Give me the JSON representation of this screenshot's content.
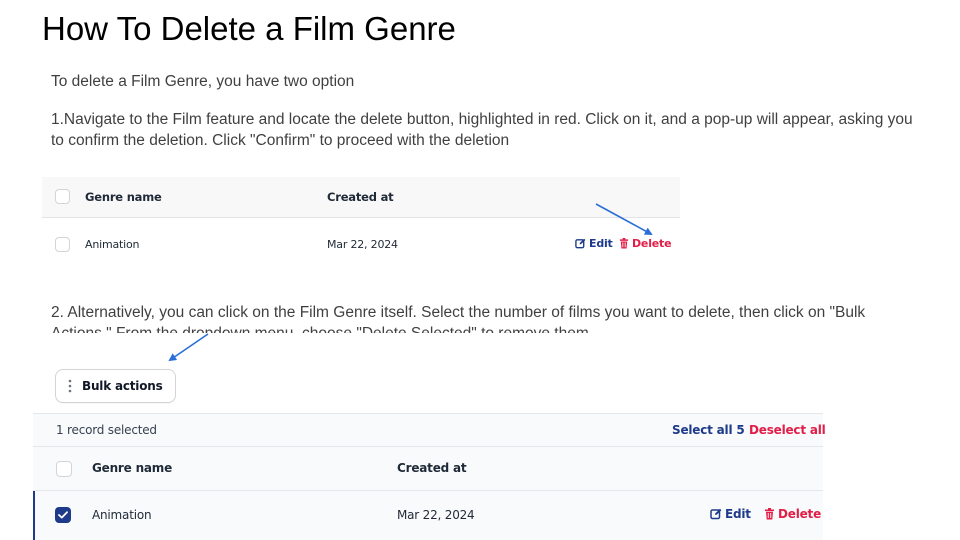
{
  "slide": {
    "title": "How To Delete a Film Genre",
    "intro": "To delete a Film Genre, you have two option",
    "step1": "1.Navigate to the Film feature and locate the delete button, highlighted in red. Click on it, and a pop-up will appear, asking you to confirm the deletion. Click \"Confirm\" to proceed with the deletion",
    "step2": "2. Alternatively, you can click on the Film Genre itself. Select the number of films you want to delete, then click on \"Bulk Actions.\" From the dropdown menu, choose \"Delete Selected\" to remove them."
  },
  "table1": {
    "columns": [
      "Genre name",
      "Created at"
    ],
    "rows": [
      {
        "genre": "Animation",
        "created": "Mar 22, 2024",
        "checked": false
      }
    ],
    "actions": {
      "edit": "Edit",
      "delete": "Delete"
    }
  },
  "table2": {
    "bulk_label": "Bulk actions",
    "selection_status": "1 record selected",
    "select_all": "Select all 5",
    "deselect_all": "Deselect all",
    "columns": [
      "Genre name",
      "Created at"
    ],
    "rows": [
      {
        "genre": "Animation",
        "created": "Mar 22, 2024",
        "checked": true
      }
    ],
    "actions": {
      "edit": "Edit",
      "delete": "Delete"
    }
  },
  "colors": {
    "primary": "#1e3a8a",
    "danger": "#e11d48",
    "arrow": "#2b6fd6",
    "title": "#000000",
    "body_text": "#404040"
  },
  "icons": {
    "edit": "pencil-square-icon",
    "delete": "trash-icon",
    "bulk": "vertical-dots-icon",
    "check": "check-icon",
    "arrow": "arrow-icon"
  }
}
